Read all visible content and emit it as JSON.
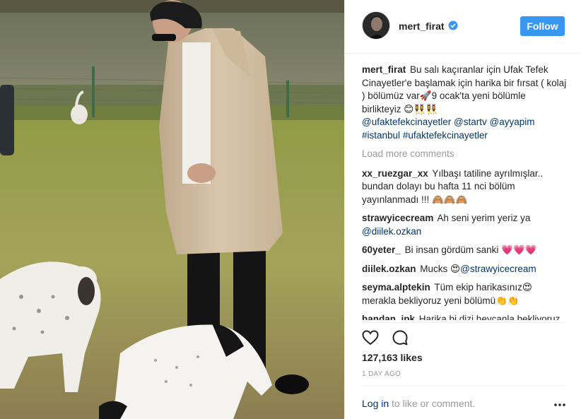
{
  "post": {
    "username": "mert_firat",
    "follow_label": "Follow",
    "caption": {
      "username": "mert_firat",
      "text": "Bu salı kaçıranlar için Ufak Tefek Cinayetler'e başlamak için harika bir fırsat ( kolaj ) bölümüz var🚀9 ocak'ta yeni bölümle birlikteyiz 😊👯‍♀️👯‍♀️",
      "mentions": [
        "@ufaktefekcinayetler",
        "@startv",
        "@ayyapim"
      ],
      "hashtags": [
        "#istanbul",
        "#ufaktefekcinayetler"
      ]
    },
    "load_more_label": "Load more comments",
    "comments": [
      {
        "user": "xx_ruezgar_xx",
        "text": "Yılbaşı tatiline ayrılmışlar.. bundan dolayı bu hafta 11 nci bölüm yayınlanmadı !!! 🙈🙈🙈"
      },
      {
        "user": "strawyicecream",
        "text": "Ah seni yerim yeriz ya",
        "mention": "@diilek.ozkan"
      },
      {
        "user": "60yeter_",
        "text": "Bi insan gördüm sanki 💗💗💗"
      },
      {
        "user": "diilek.ozkan",
        "text": "Mucks 😍",
        "mention": "@strawyicecream"
      },
      {
        "user": "seyma.alptekin",
        "text": "Tüm ekip harikasınız😍 merakla bekliyoruz yeni bölümü👏👏"
      },
      {
        "user": "handan_ipk",
        "text": "Harika bi dizi heycanla bekliyoruz😍😍"
      }
    ],
    "likes": "127,163 likes",
    "time": "1 DAY AGO",
    "footer": {
      "login": "Log in",
      "rest": " to like or comment."
    }
  },
  "icons": [
    "verified-icon",
    "heart-icon",
    "comment-icon",
    "more-options-icon"
  ],
  "colors": {
    "follow": "#3897f0",
    "link": "#003569",
    "muted": "#999999",
    "text": "#262626"
  }
}
